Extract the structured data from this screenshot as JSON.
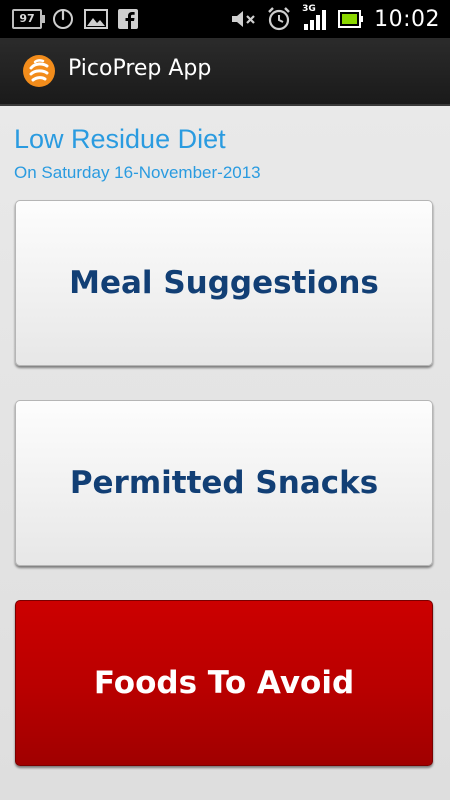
{
  "status_bar": {
    "battery_percent_label": "97",
    "time": "10:02",
    "network_label": "3G",
    "icons": [
      "battery-icon",
      "sync-icon",
      "image-icon",
      "facebook-icon",
      "mute-icon",
      "alarm-icon",
      "signal-icon",
      "battery-full-icon"
    ],
    "colors": {
      "background": "#000000",
      "battery_fill": "#8bd600"
    }
  },
  "app_bar": {
    "title": "PicoPrep App",
    "logo_icon": "picoprep-logo-icon",
    "colors": {
      "logo": "#f28c1b",
      "background": "#222222"
    }
  },
  "main": {
    "diet_title": "Low Residue Diet",
    "date_line": "On Saturday 16-November-2013",
    "buttons": [
      {
        "label": "Meal Suggestions",
        "style": "light"
      },
      {
        "label": "Permitted Snacks",
        "style": "light"
      },
      {
        "label": "Foods To Avoid",
        "style": "red"
      }
    ],
    "colors": {
      "accent_text": "#2a9be0",
      "button_text_dark": "#123f75",
      "danger_button": "#c00000"
    }
  }
}
